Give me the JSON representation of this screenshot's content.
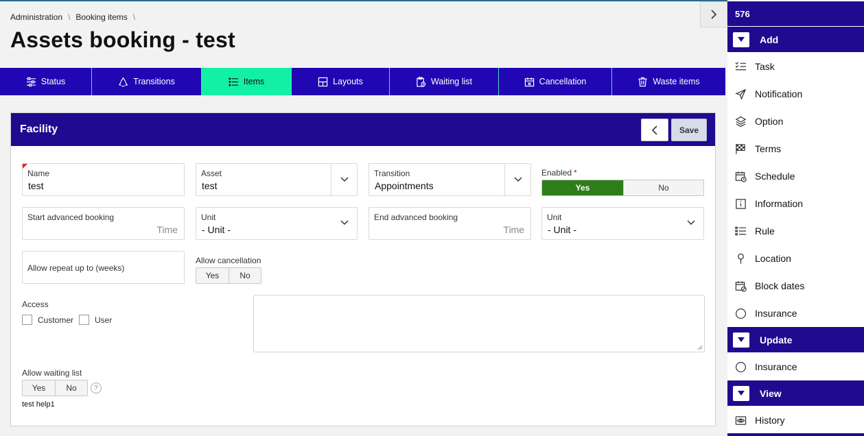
{
  "breadcrumb": [
    "Administration",
    "Booking items"
  ],
  "page_title": "Assets booking - test",
  "tabs": [
    {
      "label": "Status",
      "icon": "sliders-icon",
      "active": false
    },
    {
      "label": "Transitions",
      "icon": "recycle-icon",
      "active": false
    },
    {
      "label": "Items",
      "icon": "list-icon",
      "active": true
    },
    {
      "label": "Layouts",
      "icon": "layout-icon",
      "active": false
    },
    {
      "label": "Waiting list",
      "icon": "clipboard-clock-icon",
      "active": false
    },
    {
      "label": "Cancellation",
      "icon": "calendar-x-icon",
      "active": false
    },
    {
      "label": "Waste items",
      "icon": "trash-icon",
      "active": false
    }
  ],
  "panel": {
    "title": "Facility",
    "save_label": "Save",
    "name": {
      "label": "Name",
      "value": "test"
    },
    "asset": {
      "label": "Asset",
      "value": "test"
    },
    "transition": {
      "label": "Transition",
      "value": "Appointments"
    },
    "enabled": {
      "label": "Enabled",
      "required_mark": "*",
      "yes": "Yes",
      "no": "No",
      "selected": "Yes"
    },
    "start_advanced": {
      "label": "Start advanced booking",
      "hint": "Time"
    },
    "unit1": {
      "label": "Unit",
      "value": "- Unit -"
    },
    "end_advanced": {
      "label": "End advanced booking",
      "hint": "Time"
    },
    "unit2": {
      "label": "Unit",
      "value": "- Unit -"
    },
    "allow_repeat": {
      "label": "Allow repeat up to (weeks)"
    },
    "allow_cancellation": {
      "label": "Allow cancellation",
      "yes": "Yes",
      "no": "No"
    },
    "access": {
      "label": "Access",
      "customer": "Customer",
      "user": "User"
    },
    "allow_waiting": {
      "label": "Allow waiting list",
      "yes": "Yes",
      "no": "No",
      "help": "?"
    },
    "help_text": "test help1"
  },
  "sidebar": {
    "count": "576",
    "sections": [
      {
        "title": "Add",
        "items": [
          {
            "label": "Task",
            "icon": "checklist-icon"
          },
          {
            "label": "Notification",
            "icon": "paper-plane-icon"
          },
          {
            "label": "Option",
            "icon": "layers-icon"
          },
          {
            "label": "Terms",
            "icon": "checkered-flag-icon"
          },
          {
            "label": "Schedule",
            "icon": "calendar-clock-icon"
          },
          {
            "label": "Information",
            "icon": "info-icon"
          },
          {
            "label": "Rule",
            "icon": "list-rule-icon"
          },
          {
            "label": "Location",
            "icon": "location-pin-icon"
          },
          {
            "label": "Block dates",
            "icon": "calendar-block-icon"
          },
          {
            "label": "Insurance",
            "icon": "circle-icon"
          }
        ]
      },
      {
        "title": "Update",
        "items": [
          {
            "label": "Insurance",
            "icon": "circle-icon"
          }
        ]
      },
      {
        "title": "View",
        "items": [
          {
            "label": "History",
            "icon": "eye-icon"
          }
        ]
      }
    ]
  },
  "colors": {
    "primary": "#200a8f",
    "tab_bar": "#2106b3",
    "active_tab": "#12f0a6",
    "toggle_on": "#2f7d1a",
    "required": "#d0021b"
  }
}
